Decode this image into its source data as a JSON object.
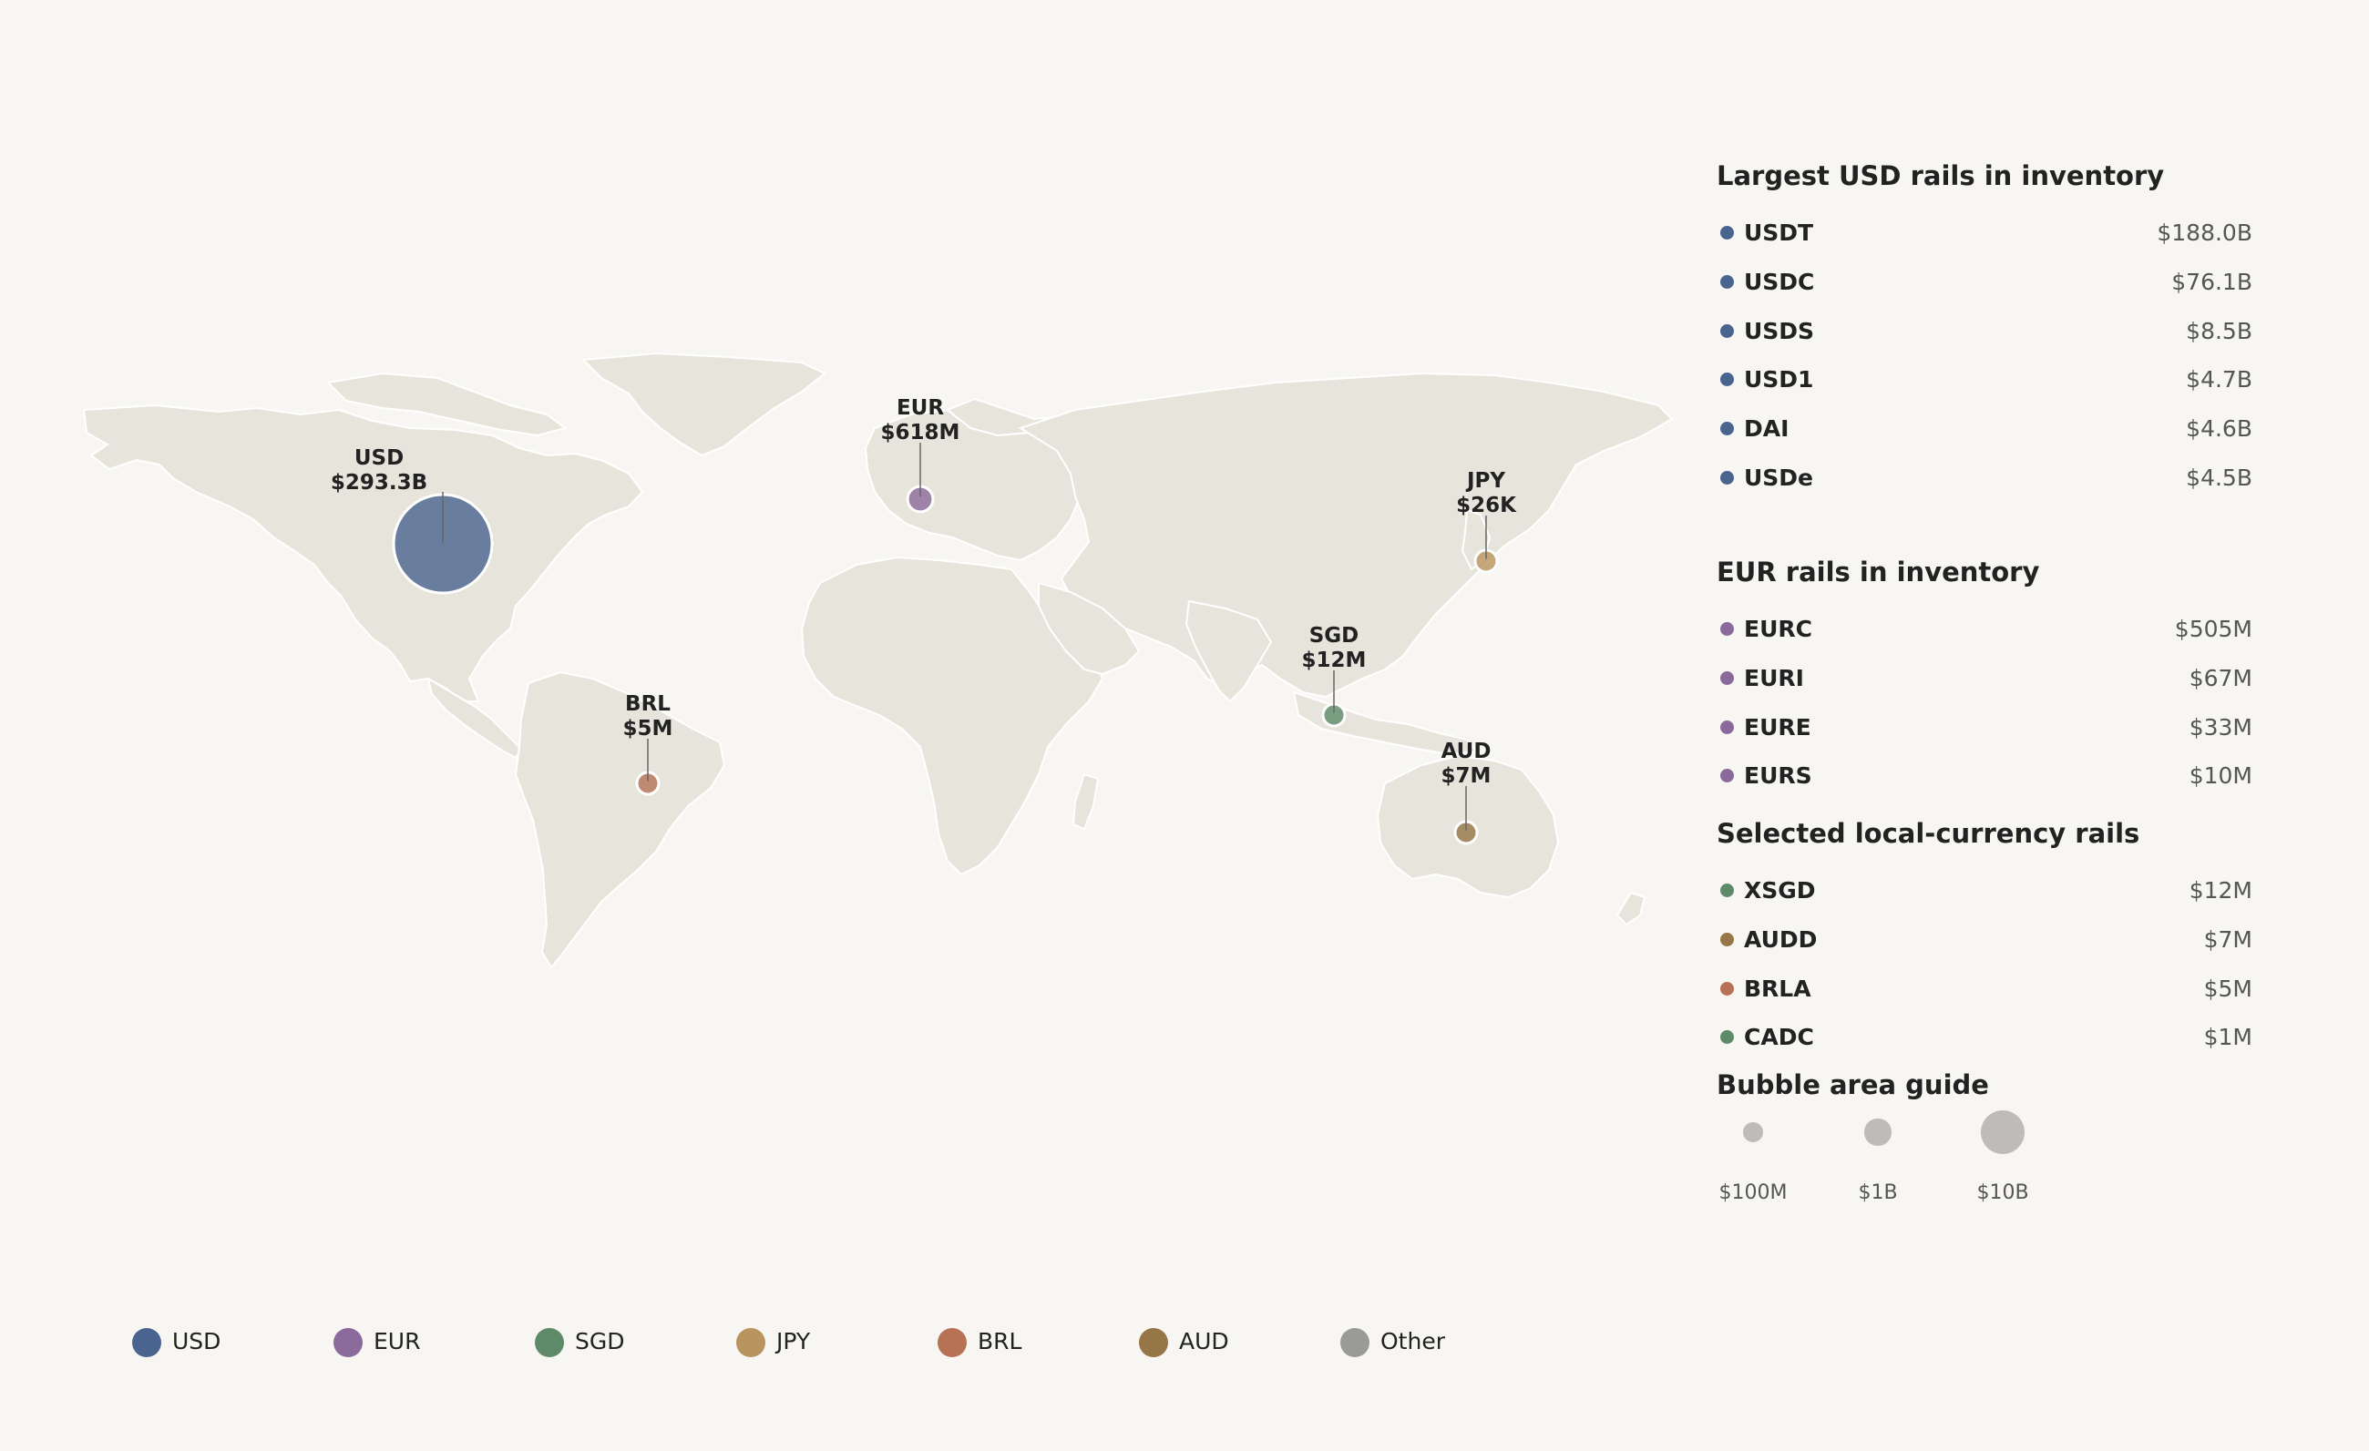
{
  "colors": {
    "USD": "#4a6490",
    "EUR": "#8a6a9a",
    "SGD": "#5f8a6a",
    "JPY": "#b9945e",
    "BRL": "#b77256",
    "AUD": "#967646",
    "Other": "#9a9a98"
  },
  "map": {
    "bubbles": [
      {
        "code": "USD",
        "amount": "$293.3B",
        "value_usd": 293300000000
      },
      {
        "code": "EUR",
        "amount": "$618M",
        "value_usd": 618000000
      },
      {
        "code": "JPY",
        "amount": "$26K",
        "value_usd": 26000
      },
      {
        "code": "SGD",
        "amount": "$12M",
        "value_usd": 12000000
      },
      {
        "code": "BRL",
        "amount": "$5M",
        "value_usd": 5000000
      },
      {
        "code": "AUD",
        "amount": "$7M",
        "value_usd": 7000000
      }
    ]
  },
  "panel": {
    "usd_title": "Largest USD rails in inventory",
    "usd_rails": [
      {
        "name": "USDT",
        "value": "$188.0B"
      },
      {
        "name": "USDC",
        "value": "$76.1B"
      },
      {
        "name": "USDS",
        "value": "$8.5B"
      },
      {
        "name": "USD1",
        "value": "$4.7B"
      },
      {
        "name": "DAI",
        "value": "$4.6B"
      },
      {
        "name": "USDe",
        "value": "$4.5B"
      }
    ],
    "eur_title": "EUR rails in inventory",
    "eur_rails": [
      {
        "name": "EURC",
        "value": "$505M"
      },
      {
        "name": "EURI",
        "value": "$67M"
      },
      {
        "name": "EURE",
        "value": "$33M"
      },
      {
        "name": "EURS",
        "value": "$10M"
      }
    ],
    "local_title": "Selected local-currency rails",
    "local_rails": [
      {
        "name": "XSGD",
        "value": "$12M",
        "color_key": "SGD"
      },
      {
        "name": "AUDD",
        "value": "$7M",
        "color_key": "AUD"
      },
      {
        "name": "BRLA",
        "value": "$5M",
        "color_key": "BRL"
      },
      {
        "name": "CADC",
        "value": "$1M",
        "color_key": "SGD"
      }
    ],
    "guide_title": "Bubble area guide",
    "guide": [
      {
        "label": "$100M",
        "value_usd": 100000000
      },
      {
        "label": "$1B",
        "value_usd": 1000000000
      },
      {
        "label": "$10B",
        "value_usd": 10000000000
      }
    ]
  },
  "legend": [
    "USD",
    "EUR",
    "SGD",
    "JPY",
    "BRL",
    "AUD",
    "Other"
  ]
}
